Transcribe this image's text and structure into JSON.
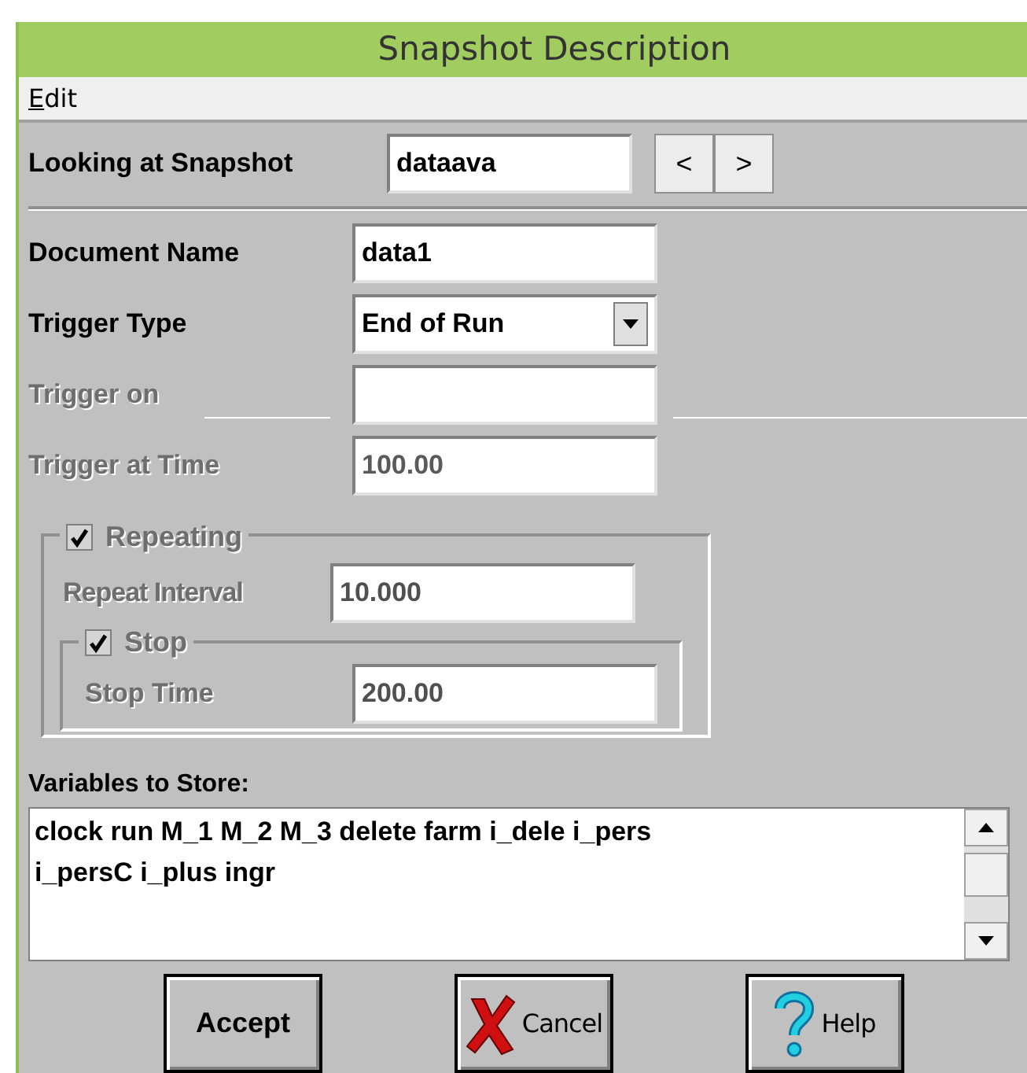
{
  "window": {
    "title": "Snapshot Description"
  },
  "menu": [
    {
      "mnemonic": "E",
      "rest": "dit"
    }
  ],
  "snapshot": {
    "label": "Looking at Snapshot",
    "value": "dataava",
    "prev": "<",
    "next": ">"
  },
  "fields": [
    {
      "label": "Document Name",
      "value": "data1",
      "kind": "text",
      "disabled": false
    },
    {
      "label": "Trigger Type",
      "value": "End of Run",
      "kind": "dropdown",
      "disabled": false
    },
    {
      "label": "Trigger on",
      "kind": "ruled",
      "disabled": true
    },
    {
      "label": "Trigger at Time",
      "value": "100.00",
      "kind": "text",
      "disabled": true
    }
  ],
  "repeating": {
    "label": "Repeating",
    "checked": true,
    "disabled": true,
    "interval": {
      "label": "Repeat Interval",
      "value": "10.000",
      "disabled": true
    },
    "stop": {
      "label": "Stop",
      "checked": true,
      "disabled": true,
      "time": {
        "label": "Stop Time",
        "value": "200.00",
        "disabled": true
      }
    }
  },
  "variables": {
    "label": "Variables to Store:",
    "value": "clock run M_1 M_2 M_3 delete farm i_dele i_pers i_persC i_plus ingr"
  },
  "buttons": [
    {
      "label": "Accept",
      "kind": "plain"
    },
    {
      "label": "Cancel",
      "kind": "cancel"
    },
    {
      "label": "Help",
      "kind": "help"
    }
  ]
}
